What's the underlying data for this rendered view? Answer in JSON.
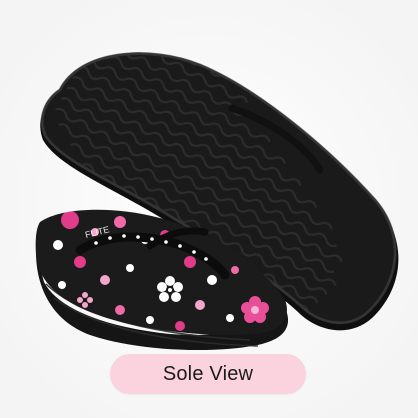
{
  "caption": {
    "label": "Sole View"
  },
  "product": {
    "brand_mark": "FLITE"
  },
  "colors": {
    "caption_bg": "#fad3df",
    "top_pill": "#f8c9d6",
    "sole": "#141414",
    "footbed_accent": "#e03c8a",
    "background": "#ffffff"
  }
}
